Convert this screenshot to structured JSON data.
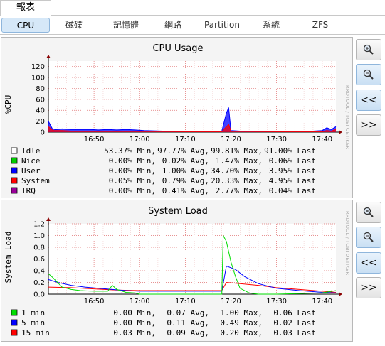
{
  "top_tab": "報表",
  "subtabs": [
    "CPU",
    "磁碟",
    "記憶體",
    "網路",
    "Partition",
    "系統",
    "ZFS"
  ],
  "side_buttons": {
    "back": "<<",
    "forward": ">>",
    "zoom_in": "zoom-in-icon",
    "zoom_out": "zoom-out-icon"
  },
  "watermark": "RRDTOOL / TOBI OETIKER",
  "colors": {
    "idle": "#ffffff",
    "nice": "#00cc00",
    "user": "#0000ff",
    "system": "#ff0000",
    "irq": "#990099",
    "load1": "#00dd00",
    "load5": "#0000ff",
    "load15": "#ff0000"
  },
  "cpu": {
    "title": "CPU Usage",
    "ylabel": "%CPU",
    "legend": [
      {
        "name": "Idle",
        "min": "53.37% Min,",
        "avg": "97.77% Avg,",
        "max": "99.81% Max,",
        "last": "91.00% Last",
        "color": "#ffffff"
      },
      {
        "name": "Nice",
        "min": "0.00% Min,",
        "avg": "0.02% Avg,",
        "max": "1.47% Max,",
        "last": "0.06% Last",
        "color": "#00cc00"
      },
      {
        "name": "User",
        "min": "0.00% Min,",
        "avg": "1.00% Avg,",
        "max": "34.70% Max,",
        "last": "3.95% Last",
        "color": "#0000ff"
      },
      {
        "name": "System",
        "min": "0.05% Min,",
        "avg": "0.79% Avg,",
        "max": "20.33% Max,",
        "last": "4.95% Last",
        "color": "#ff0000"
      },
      {
        "name": "IRQ",
        "min": "0.00% Min,",
        "avg": "0.41% Avg,",
        "max": "2.77% Max,",
        "last": "0.04% Last",
        "color": "#990099"
      }
    ]
  },
  "load": {
    "title": "System Load",
    "ylabel": "System Load",
    "legend": [
      {
        "name": "1 min",
        "min": "0.00 Min,",
        "avg": "0.07 Avg,",
        "max": "1.00 Max,",
        "last": "0.06 Last",
        "color": "#00dd00"
      },
      {
        "name": "5 min",
        "min": "0.00 Min,",
        "avg": "0.11 Avg,",
        "max": "0.49 Max,",
        "last": "0.02 Last",
        "color": "#0000ff"
      },
      {
        "name": "15 min",
        "min": "0.03 Min,",
        "avg": "0.09 Avg,",
        "max": "0.20 Max,",
        "last": "0.03 Last",
        "color": "#ff0000"
      }
    ]
  },
  "chart_data": [
    {
      "type": "area",
      "title": "CPU Usage",
      "xlabel": "",
      "ylabel": "%CPU",
      "ylim": [
        0,
        130
      ],
      "yticks": [
        0,
        20,
        40,
        60,
        80,
        100,
        120
      ],
      "x_range": [
        "16:40",
        "17:43"
      ],
      "xticks": [
        "16:50",
        "17:00",
        "17:10",
        "17:20",
        "17:30",
        "17:40"
      ],
      "grid": true,
      "series": [
        {
          "name": "User",
          "x": [
            "16:40",
            "16:41",
            "16:43",
            "16:45",
            "16:47",
            "16:49",
            "16:51",
            "16:53",
            "16:55",
            "16:57",
            "16:59",
            "17:01",
            "17:05",
            "17:10",
            "17:15",
            "17:18",
            "17:19",
            "17:19.5",
            "17:20",
            "17:22",
            "17:26",
            "17:30",
            "17:34",
            "17:38",
            "17:40",
            "17:41",
            "17:42",
            "17:43"
          ],
          "values": [
            20,
            4,
            6,
            5,
            5,
            5,
            4,
            5,
            4,
            5,
            4,
            3,
            2,
            2,
            2,
            2,
            35,
            45,
            3,
            2,
            2,
            2,
            2,
            2,
            3,
            8,
            5,
            10
          ]
        },
        {
          "name": "System",
          "x": [
            "16:40",
            "16:41",
            "16:43",
            "16:45",
            "16:50",
            "16:55",
            "17:00",
            "17:10",
            "17:18",
            "17:19",
            "17:19.5",
            "17:20",
            "17:30",
            "17:40",
            "17:41",
            "17:42",
            "17:43"
          ],
          "values": [
            10,
            3,
            3,
            2,
            2,
            2,
            2,
            1,
            1,
            10,
            14,
            2,
            1,
            1,
            3,
            2,
            5
          ]
        }
      ]
    },
    {
      "type": "line",
      "title": "System Load",
      "xlabel": "",
      "ylabel": "System Load",
      "ylim": [
        0,
        1.2
      ],
      "yticks": [
        0.0,
        0.2,
        0.4,
        0.6,
        0.8,
        1.0,
        1.2
      ],
      "x_range": [
        "16:40",
        "17:43"
      ],
      "xticks": [
        "16:50",
        "17:00",
        "17:10",
        "17:20",
        "17:30",
        "17:40"
      ],
      "grid": true,
      "series": [
        {
          "name": "1 min",
          "x": [
            "16:40",
            "16:41",
            "16:43",
            "16:45",
            "16:47",
            "16:50",
            "16:53",
            "16:54",
            "16:55",
            "16:57",
            "16:59",
            "17:00",
            "17:18",
            "17:18.3",
            "17:19",
            "17:20",
            "17:21",
            "17:22",
            "17:24",
            "17:26",
            "17:30",
            "17:40",
            "17:43"
          ],
          "values": [
            0.35,
            0.28,
            0.12,
            0.08,
            0.06,
            0.05,
            0.05,
            0.15,
            0.08,
            0.03,
            0.02,
            0.0,
            0.0,
            1.0,
            0.9,
            0.55,
            0.3,
            0.1,
            0.02,
            0.0,
            0.0,
            0.02,
            0.06
          ]
        },
        {
          "name": "5 min",
          "x": [
            "16:40",
            "16:42",
            "16:45",
            "16:48",
            "16:51",
            "16:54",
            "16:57",
            "17:00",
            "17:18",
            "17:19",
            "17:21",
            "17:23",
            "17:26",
            "17:30",
            "17:35",
            "17:40",
            "17:43"
          ],
          "values": [
            0.25,
            0.2,
            0.15,
            0.12,
            0.1,
            0.08,
            0.06,
            0.05,
            0.05,
            0.48,
            0.42,
            0.3,
            0.18,
            0.1,
            0.06,
            0.03,
            0.02
          ]
        },
        {
          "name": "15 min",
          "x": [
            "16:40",
            "16:45",
            "16:50",
            "16:55",
            "17:00",
            "17:18",
            "17:19",
            "17:22",
            "17:26",
            "17:30",
            "17:35",
            "17:40",
            "17:43"
          ],
          "values": [
            0.12,
            0.11,
            0.09,
            0.07,
            0.06,
            0.06,
            0.2,
            0.18,
            0.15,
            0.11,
            0.08,
            0.05,
            0.03
          ]
        }
      ]
    }
  ]
}
